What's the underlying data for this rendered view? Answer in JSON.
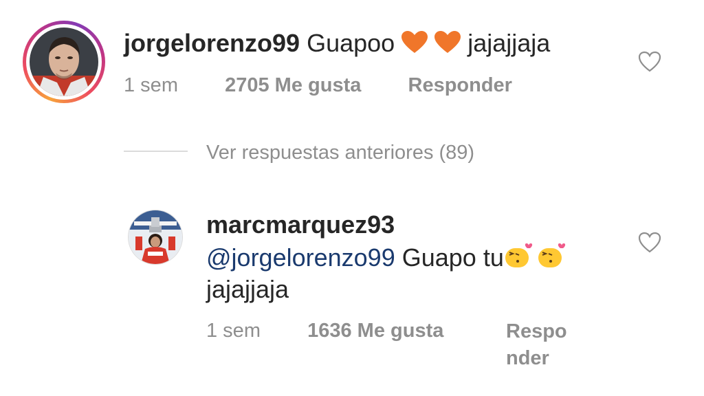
{
  "comment": {
    "username": "jorgelorenzo99",
    "text_before": "Guapoo",
    "emoji": "❤️❤️",
    "text_after": "jajajjaja",
    "time": "1 sem",
    "likes": "2705 Me gusta",
    "reply_label": "Responder"
  },
  "view_replies": {
    "label": "Ver respuestas anteriores (89)"
  },
  "reply": {
    "username": "marcmarquez93",
    "mention": "@jorgelorenzo99",
    "text": "Guapo tu",
    "text_line2": "jajajjaja",
    "time": "1 sem",
    "likes": "1636 Me gusta",
    "reply_label_line1": "Respo",
    "reply_label_line2": "nder"
  },
  "colors": {
    "heart_emoji": "#F0762A",
    "kiss_emoji": "#FFC832",
    "mention": "#1A3A6E"
  }
}
